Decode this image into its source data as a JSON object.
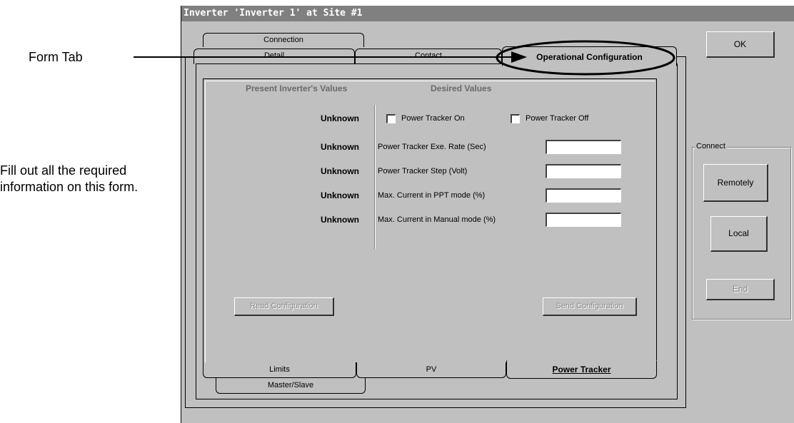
{
  "annotations": {
    "form_tab": "Form Tab",
    "instructions": "Fill out all the required information on this form."
  },
  "window": {
    "title": "Inverter 'Inverter 1' at Site #1"
  },
  "tabs_top": {
    "row1": [
      "Connection"
    ],
    "row2": [
      "Detail",
      "Contact",
      "Operational Configuration"
    ],
    "selected": "Operational Configuration"
  },
  "tabs_bottom": {
    "row1": [
      "Limits",
      "PV",
      "Power Tracker"
    ],
    "row2": [
      "Master/Slave"
    ],
    "selected": "Power Tracker"
  },
  "form": {
    "present_header": "Present Inverter's Values",
    "desired_header": "Desired Values",
    "present_values": [
      "Unknown",
      "Unknown",
      "Unknown",
      "Unknown",
      "Unknown"
    ],
    "power_tracker_on": "Power Tracker On",
    "power_tracker_off": "Power Tracker Off",
    "fields": [
      {
        "label": "Power Tracker Exe. Rate (Sec)",
        "value": ""
      },
      {
        "label": "Power Tracker Step (Volt)",
        "value": ""
      },
      {
        "label": "Max. Current in PPT mode (%)",
        "value": ""
      },
      {
        "label": "Max. Current in Manual mode (%)",
        "value": ""
      }
    ],
    "read_button": "Read Configuration",
    "send_button": "Send Configuration"
  },
  "side": {
    "ok": "OK",
    "connect_group": "Connect",
    "remotely": "Remotely",
    "local": "Local",
    "end": "End"
  }
}
